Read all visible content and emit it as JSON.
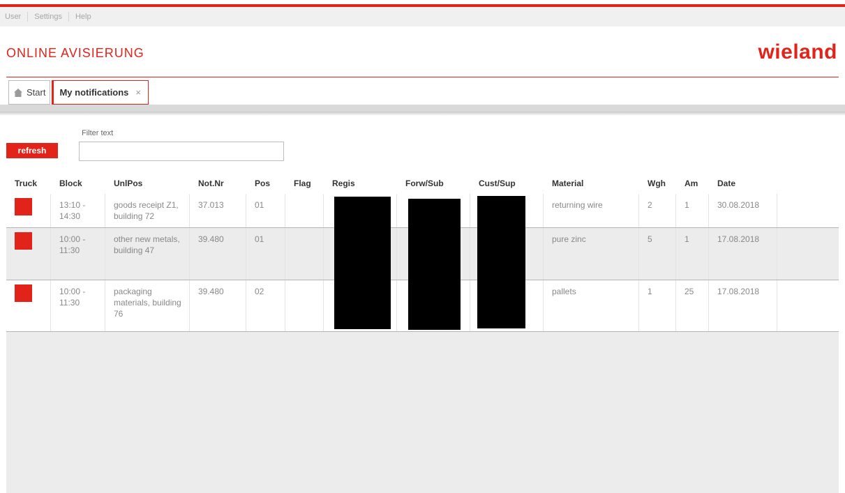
{
  "menu": {
    "items": [
      {
        "label": "User"
      },
      {
        "label": "Settings"
      },
      {
        "label": "Help"
      }
    ]
  },
  "header": {
    "title": "ONLINE AVISIERUNG",
    "brand": "wieland"
  },
  "tabs": {
    "start_label": "Start",
    "active_label": "My notifications",
    "close_glyph": "×"
  },
  "filter": {
    "label": "Filter text",
    "value": "",
    "refresh_label": "refresh"
  },
  "table": {
    "columns": [
      "Truck",
      "Block",
      "UnlPos",
      "Not.Nr",
      "Pos",
      "Flag",
      "Regis",
      "Forw/Sub",
      "Cust/Sup",
      "Material",
      "Wgh",
      "Am",
      "Date"
    ],
    "rows": [
      {
        "truck_color": "#e2231a",
        "block": "13:10 - 14:30",
        "unlpos": "goods receipt Z1, building 72",
        "notnr": "37.013",
        "pos": "01",
        "flag": "",
        "regis": "",
        "forw": "",
        "cust": "",
        "material": "returning wire",
        "wgh": "2",
        "am": "1",
        "date": "30.08.2018"
      },
      {
        "truck_color": "#e2231a",
        "block": "10:00 - 11:30",
        "unlpos": "other new metals, building 47",
        "notnr": "39.480",
        "pos": "01",
        "flag": "",
        "regis": "",
        "forw": "",
        "cust": "",
        "material": "pure zinc",
        "wgh": "5",
        "am": "1",
        "date": "17.08.2018"
      },
      {
        "truck_color": "#e2231a",
        "block": "10:00 - 11:30",
        "unlpos": "packaging materials, building 76",
        "notnr": "39.480",
        "pos": "02",
        "flag": "",
        "regis": "",
        "forw": "",
        "cust": "",
        "material": "pallets",
        "wgh": "1",
        "am": "25",
        "date": "17.08.2018"
      }
    ]
  },
  "colors": {
    "accent": "#e2231a",
    "menubar": "#f0f0f0",
    "row_alt": "#ececec"
  }
}
